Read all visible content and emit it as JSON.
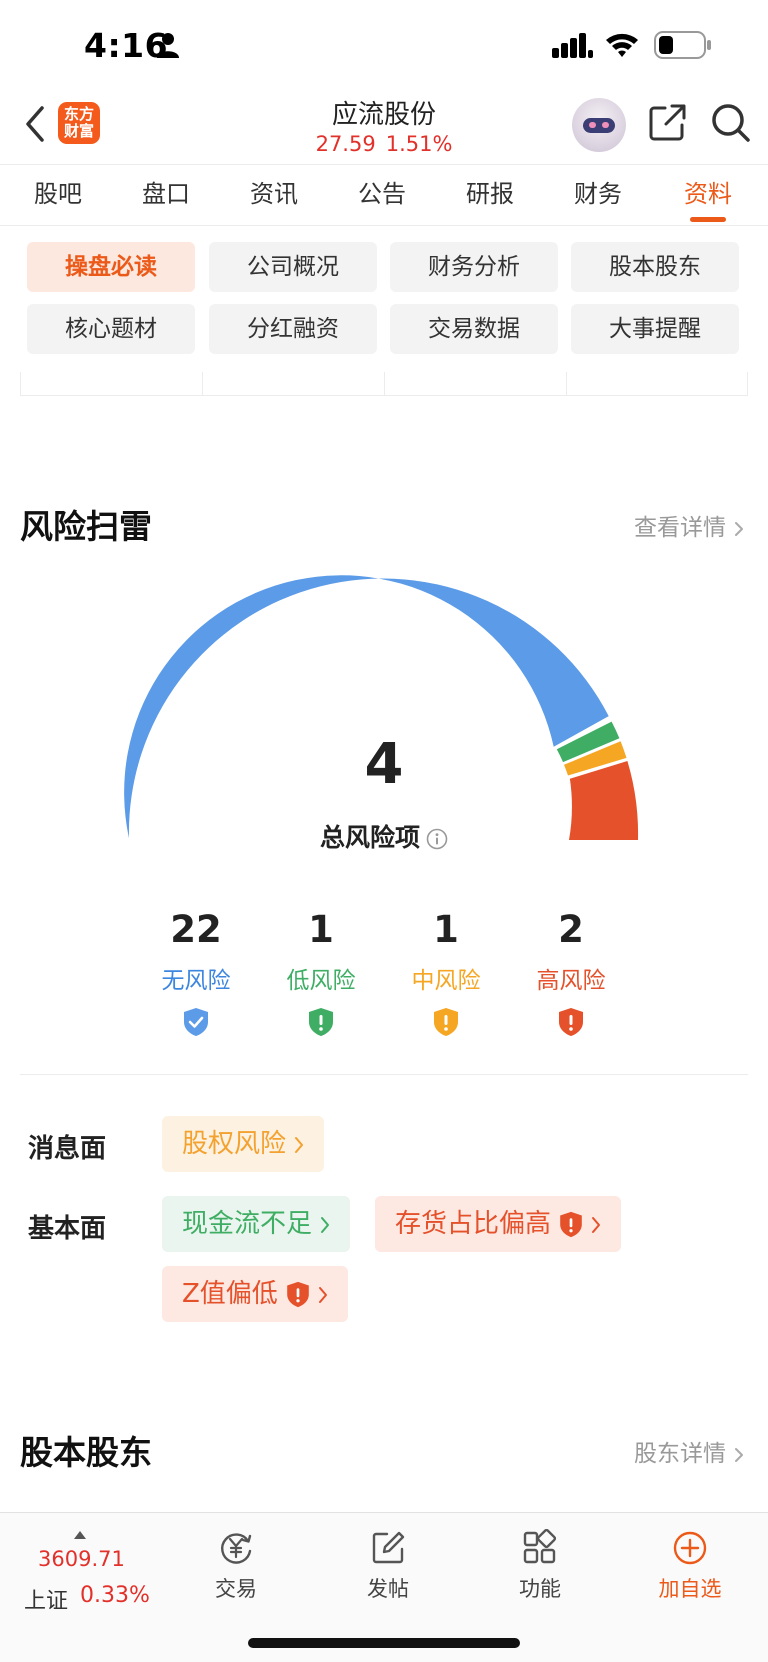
{
  "status_bar": {
    "time": "4:16"
  },
  "header": {
    "brand_logo_text": "东方财富",
    "stock_name": "应流股份",
    "price": "27.59",
    "change_pct": "1.51%"
  },
  "tabs": [
    {
      "label": "股吧",
      "active": false
    },
    {
      "label": "盘口",
      "active": false
    },
    {
      "label": "资讯",
      "active": false
    },
    {
      "label": "公告",
      "active": false
    },
    {
      "label": "研报",
      "active": false
    },
    {
      "label": "财务",
      "active": false
    },
    {
      "label": "资料",
      "active": true
    }
  ],
  "submenu": [
    {
      "label": "操盘必读",
      "active": true
    },
    {
      "label": "公司概况",
      "active": false
    },
    {
      "label": "财务分析",
      "active": false
    },
    {
      "label": "股本股东",
      "active": false
    },
    {
      "label": "核心题材",
      "active": false
    },
    {
      "label": "分红融资",
      "active": false
    },
    {
      "label": "交易数据",
      "active": false
    },
    {
      "label": "大事提醒",
      "active": false
    }
  ],
  "risk_section": {
    "title": "风险扫雷",
    "link": "查看详情",
    "total_count": "4",
    "total_label": "总风险项",
    "colors": {
      "none": "#5b9be8",
      "low": "#3fae64",
      "medium": "#f5a623",
      "high": "#e4512a"
    },
    "stats": [
      {
        "count": "22",
        "label": "无风险",
        "level": "none"
      },
      {
        "count": "1",
        "label": "低风险",
        "level": "low"
      },
      {
        "count": "1",
        "label": "中风险",
        "level": "medium"
      },
      {
        "count": "2",
        "label": "高风险",
        "level": "high"
      }
    ],
    "rows": [
      {
        "label": "消息面",
        "tags": [
          {
            "text": "股权风险",
            "level": "medium"
          }
        ]
      },
      {
        "label": "基本面",
        "tags": [
          {
            "text": "现金流不足",
            "level": "low"
          },
          {
            "text": "存货占比偏高",
            "level": "high"
          },
          {
            "text": "Z值偏低",
            "level": "high"
          }
        ]
      }
    ]
  },
  "shareholder_section": {
    "title": "股本股东",
    "link": "股东详情"
  },
  "bottom_bar": {
    "index_value": "3609.71",
    "index_name": "上证",
    "index_change": "0.33%",
    "items": [
      {
        "label": "交易",
        "icon": "yuan-exchange-icon"
      },
      {
        "label": "发帖",
        "icon": "compose-icon"
      },
      {
        "label": "功能",
        "icon": "grid-icon"
      },
      {
        "label": "加自选",
        "icon": "add-circle-icon"
      }
    ]
  }
}
